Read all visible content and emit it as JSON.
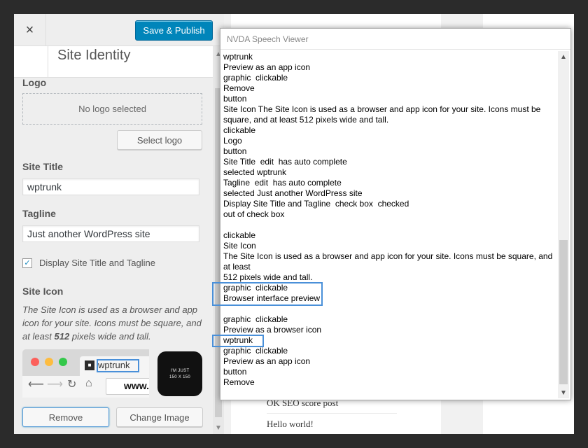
{
  "customizer": {
    "close_icon": "×",
    "publish_label": "Save & Publish",
    "section_title": "Site Identity",
    "logo": {
      "label": "Logo",
      "placeholder": "No logo selected",
      "select_label": "Select logo"
    },
    "site_title": {
      "label": "Site Title",
      "value": "wptrunk"
    },
    "tagline": {
      "label": "Tagline",
      "value": "Just another WordPress site"
    },
    "display_title_tagline": {
      "label": "Display Site Title and Tagline",
      "checked": true,
      "check_glyph": "✓"
    },
    "site_icon": {
      "label": "Site Icon",
      "desc_before": "The Site Icon is used as a browser and app icon for your site. Icons must be square, and at least ",
      "desc_bold": "512",
      "desc_after": " pixels wide and tall.",
      "browser_tab_title": "wptrunk",
      "browser_url": "www.",
      "app_icon_line1": "I'M JUST",
      "app_icon_line2": "150 X 150",
      "remove_label": "Remove",
      "change_label": "Change Image"
    }
  },
  "preview": {
    "posts": [
      "OK SEO score post",
      "Hello world!"
    ]
  },
  "speech_viewer": {
    "title": "NVDA Speech Viewer",
    "lines": [
      "wptrunk",
      "Preview as an app icon",
      "graphic  clickable",
      "Remove",
      "button",
      "Site Icon The Site Icon is used as a browser and app icon for your site. Icons must be square, and at least 512 pixels wide and tall.",
      "clickable",
      "Logo",
      "button",
      "Site Title  edit  has auto complete",
      "selected wptrunk",
      "Tagline  edit  has auto complete",
      "selected Just another WordPress site",
      "Display Site Title and Tagline  check box  checked",
      "out of check box",
      "",
      "clickable",
      "Site Icon",
      "The Site Icon is used as a browser and app icon for your site. Icons must be square, and at least",
      "512 pixels wide and tall.",
      "graphic  clickable",
      "Browser interface preview",
      "",
      "graphic  clickable",
      "Preview as a browser icon",
      "wptrunk",
      "graphic  clickable",
      "Preview as an app icon",
      "button",
      "Remove"
    ]
  },
  "colors": {
    "publish": "#0085ba",
    "highlight": "#4a90d9"
  }
}
